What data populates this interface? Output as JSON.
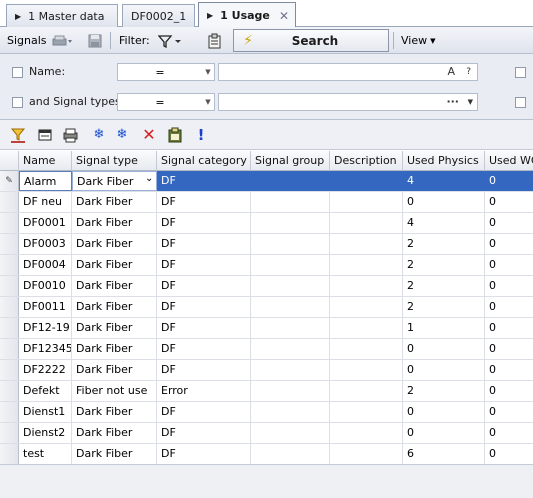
{
  "tabs": [
    {
      "label": "1 Master data",
      "has_arrow": true
    },
    {
      "label": "DF0002_1",
      "has_arrow": false
    },
    {
      "label": "1 Usage",
      "has_arrow": true,
      "active": true,
      "close": "✕"
    }
  ],
  "toolbar": {
    "signals_label": "Signals",
    "filter_label": "Filter:",
    "search_label": "Search",
    "view_label": "View"
  },
  "filter": {
    "rows": [
      {
        "label": "Name:",
        "operator": "=",
        "value": "",
        "right_glyph": "A",
        "help_glyph": "?"
      },
      {
        "label": "and Signal types:",
        "operator": "=",
        "value": "",
        "right_glyph": "···"
      }
    ]
  },
  "grid": {
    "columns": [
      "Name",
      "Signal type",
      "Signal category",
      "Signal group",
      "Description",
      "Used Physics",
      "Used WC"
    ],
    "rows": [
      {
        "name": "Alarm",
        "type": "Dark Fiber",
        "category": "DF",
        "group": "",
        "description": "",
        "physics": "4",
        "wc": "0",
        "selected": true
      },
      {
        "name": "DF neu",
        "type": "Dark Fiber",
        "category": "DF",
        "group": "",
        "description": "",
        "physics": "0",
        "wc": "0"
      },
      {
        "name": "DF0001",
        "type": "Dark Fiber",
        "category": "DF",
        "group": "",
        "description": "",
        "physics": "4",
        "wc": "0"
      },
      {
        "name": "DF0003",
        "type": "Dark Fiber",
        "category": "DF",
        "group": "",
        "description": "",
        "physics": "2",
        "wc": "0"
      },
      {
        "name": "DF0004",
        "type": "Dark Fiber",
        "category": "DF",
        "group": "",
        "description": "",
        "physics": "2",
        "wc": "0"
      },
      {
        "name": "DF0010",
        "type": "Dark Fiber",
        "category": "DF",
        "group": "",
        "description": "",
        "physics": "2",
        "wc": "0"
      },
      {
        "name": "DF0011",
        "type": "Dark Fiber",
        "category": "DF",
        "group": "",
        "description": "",
        "physics": "2",
        "wc": "0"
      },
      {
        "name": "DF12-19",
        "type": "Dark Fiber",
        "category": "DF",
        "group": "",
        "description": "",
        "physics": "1",
        "wc": "0"
      },
      {
        "name": "DF12345",
        "type": "Dark Fiber",
        "category": "DF",
        "group": "",
        "description": "",
        "physics": "0",
        "wc": "0"
      },
      {
        "name": "DF2222",
        "type": "Dark Fiber",
        "category": "DF",
        "group": "",
        "description": "",
        "physics": "0",
        "wc": "0"
      },
      {
        "name": "Defekt",
        "type": "Fiber not use",
        "category": "Error",
        "group": "",
        "description": "",
        "physics": "2",
        "wc": "0"
      },
      {
        "name": "Dienst1",
        "type": "Dark Fiber",
        "category": "DF",
        "group": "",
        "description": "",
        "physics": "0",
        "wc": "0"
      },
      {
        "name": "Dienst2",
        "type": "Dark Fiber",
        "category": "DF",
        "group": "",
        "description": "",
        "physics": "0",
        "wc": "0"
      },
      {
        "name": "test",
        "type": "Dark Fiber",
        "category": "DF",
        "group": "",
        "description": "",
        "physics": "6",
        "wc": "0"
      }
    ]
  },
  "colors": {
    "selection": "#3468c0",
    "search_bolt": "#c9a400",
    "delete_red": "#d32020",
    "exclamation_blue": "#1c3fd0"
  }
}
